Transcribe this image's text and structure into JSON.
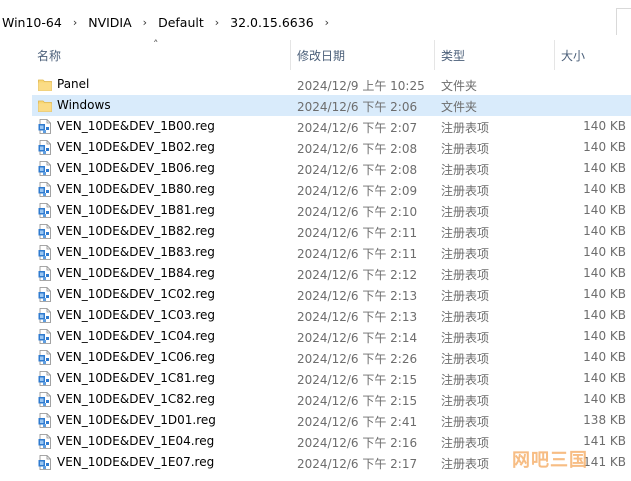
{
  "breadcrumb": [
    "Win10-64",
    "NVIDIA",
    "Default",
    "32.0.15.6636"
  ],
  "columns": {
    "name": "名称",
    "date": "修改日期",
    "type": "类型",
    "size": "大小"
  },
  "rows": [
    {
      "icon": "folder-icon",
      "name": "Panel",
      "date": "2024/12/9 上午 10:25",
      "type": "文件夹",
      "size": ""
    },
    {
      "icon": "folder-icon",
      "name": "Windows",
      "date": "2024/12/6 下午 2:06",
      "type": "文件夹",
      "size": "",
      "selected": true
    },
    {
      "icon": "reg-file-icon",
      "name": "VEN_10DE&DEV_1B00.reg",
      "date": "2024/12/6 下午 2:07",
      "type": "注册表项",
      "size": "140 KB"
    },
    {
      "icon": "reg-file-icon",
      "name": "VEN_10DE&DEV_1B02.reg",
      "date": "2024/12/6 下午 2:08",
      "type": "注册表项",
      "size": "140 KB"
    },
    {
      "icon": "reg-file-icon",
      "name": "VEN_10DE&DEV_1B06.reg",
      "date": "2024/12/6 下午 2:08",
      "type": "注册表项",
      "size": "140 KB"
    },
    {
      "icon": "reg-file-icon",
      "name": "VEN_10DE&DEV_1B80.reg",
      "date": "2024/12/6 下午 2:09",
      "type": "注册表项",
      "size": "140 KB"
    },
    {
      "icon": "reg-file-icon",
      "name": "VEN_10DE&DEV_1B81.reg",
      "date": "2024/12/6 下午 2:10",
      "type": "注册表项",
      "size": "140 KB"
    },
    {
      "icon": "reg-file-icon",
      "name": "VEN_10DE&DEV_1B82.reg",
      "date": "2024/12/6 下午 2:11",
      "type": "注册表项",
      "size": "140 KB"
    },
    {
      "icon": "reg-file-icon",
      "name": "VEN_10DE&DEV_1B83.reg",
      "date": "2024/12/6 下午 2:11",
      "type": "注册表项",
      "size": "140 KB"
    },
    {
      "icon": "reg-file-icon",
      "name": "VEN_10DE&DEV_1B84.reg",
      "date": "2024/12/6 下午 2:12",
      "type": "注册表项",
      "size": "140 KB"
    },
    {
      "icon": "reg-file-icon",
      "name": "VEN_10DE&DEV_1C02.reg",
      "date": "2024/12/6 下午 2:13",
      "type": "注册表项",
      "size": "140 KB"
    },
    {
      "icon": "reg-file-icon",
      "name": "VEN_10DE&DEV_1C03.reg",
      "date": "2024/12/6 下午 2:13",
      "type": "注册表项",
      "size": "140 KB"
    },
    {
      "icon": "reg-file-icon",
      "name": "VEN_10DE&DEV_1C04.reg",
      "date": "2024/12/6 下午 2:14",
      "type": "注册表项",
      "size": "140 KB"
    },
    {
      "icon": "reg-file-icon",
      "name": "VEN_10DE&DEV_1C06.reg",
      "date": "2024/12/6 下午 2:26",
      "type": "注册表项",
      "size": "140 KB"
    },
    {
      "icon": "reg-file-icon",
      "name": "VEN_10DE&DEV_1C81.reg",
      "date": "2024/12/6 下午 2:15",
      "type": "注册表项",
      "size": "140 KB"
    },
    {
      "icon": "reg-file-icon",
      "name": "VEN_10DE&DEV_1C82.reg",
      "date": "2024/12/6 下午 2:15",
      "type": "注册表项",
      "size": "140 KB"
    },
    {
      "icon": "reg-file-icon",
      "name": "VEN_10DE&DEV_1D01.reg",
      "date": "2024/12/6 下午 2:41",
      "type": "注册表项",
      "size": "138 KB"
    },
    {
      "icon": "reg-file-icon",
      "name": "VEN_10DE&DEV_1E04.reg",
      "date": "2024/12/6 下午 2:16",
      "type": "注册表项",
      "size": "141 KB"
    },
    {
      "icon": "reg-file-icon",
      "name": "VEN_10DE&DEV_1E07.reg",
      "date": "2024/12/6 下午 2:17",
      "type": "注册表项",
      "size": "141 KB"
    }
  ],
  "watermark": "网吧三国",
  "colors": {
    "selection": "#d9ebfb",
    "header_text": "#4c607a",
    "folder": "#f8d775",
    "reg_icon": "#2f7bd0",
    "watermark": "#f6b26e"
  }
}
